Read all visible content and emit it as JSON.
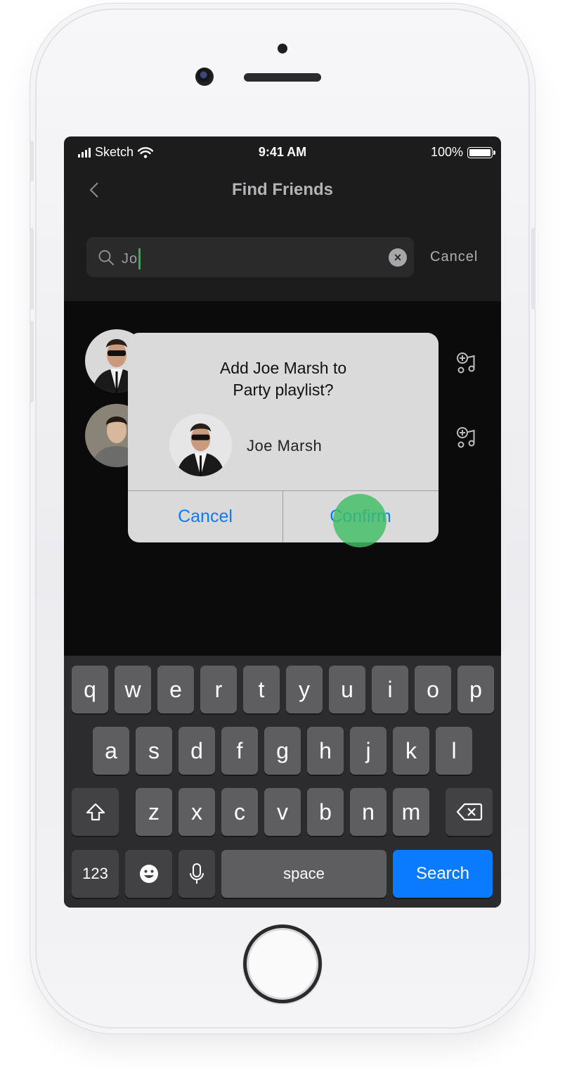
{
  "status_bar": {
    "carrier": "Sketch",
    "time": "9:41 AM",
    "battery": "100%"
  },
  "nav": {
    "title": "Find Friends",
    "back_icon": "chevron-left-icon"
  },
  "search": {
    "value": "Jo",
    "cancel_label": "Cancel",
    "accent_color": "#1db954"
  },
  "results": [
    {
      "avatar": "avatar-joe-marsh",
      "action_icon": "add-to-playlist-icon"
    },
    {
      "avatar": "avatar-friend-2",
      "action_icon": "add-to-playlist-icon"
    }
  ],
  "alert": {
    "title_line1": "Add Joe Marsh to",
    "title_line2": "Party playlist?",
    "friend_name": "Joe Marsh",
    "cancel_label": "Cancel",
    "confirm_label": "Confirm",
    "button_color": "#0a7aff"
  },
  "keyboard": {
    "row1": [
      "q",
      "w",
      "e",
      "r",
      "t",
      "y",
      "u",
      "i",
      "o",
      "p"
    ],
    "row2": [
      "a",
      "s",
      "d",
      "f",
      "g",
      "h",
      "j",
      "k",
      "l"
    ],
    "row3": [
      "z",
      "x",
      "c",
      "v",
      "b",
      "n",
      "m"
    ],
    "numbers_label": "123",
    "space_label": "space",
    "search_label": "Search",
    "search_color": "#0a7aff"
  }
}
